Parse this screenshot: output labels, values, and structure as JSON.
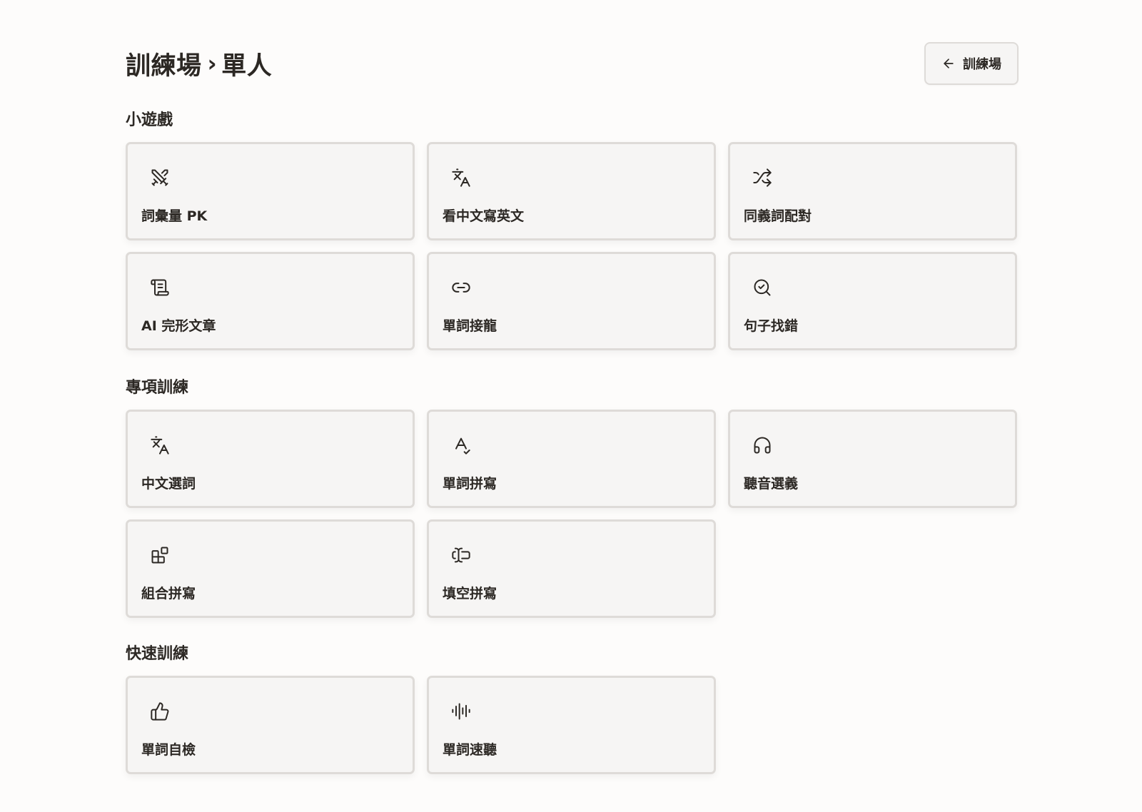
{
  "header": {
    "title_part1": "訓練場",
    "separator": "›",
    "title_part2": "單人",
    "back_button_label": "訓練場"
  },
  "sections": [
    {
      "title": "小遊戲",
      "cards": [
        {
          "label": "詞彙量 PK",
          "icon": "swords-icon"
        },
        {
          "label": "看中文寫英文",
          "icon": "translate-icon"
        },
        {
          "label": "同義詞配對",
          "icon": "shuffle-icon"
        },
        {
          "label": "AI 完形文章",
          "icon": "scroll-icon"
        },
        {
          "label": "單詞接龍",
          "icon": "link-icon"
        },
        {
          "label": "句子找錯",
          "icon": "search-check-icon"
        }
      ]
    },
    {
      "title": "專項訓練",
      "cards": [
        {
          "label": "中文選詞",
          "icon": "translate-icon"
        },
        {
          "label": "單詞拼寫",
          "icon": "spell-check-icon"
        },
        {
          "label": "聽音選義",
          "icon": "headphones-icon"
        },
        {
          "label": "組合拼寫",
          "icon": "blocks-icon"
        },
        {
          "label": "填空拼寫",
          "icon": "text-cursor-input-icon"
        }
      ]
    },
    {
      "title": "快速訓練",
      "cards": [
        {
          "label": "單詞自檢",
          "icon": "thumbs-up-icon"
        },
        {
          "label": "單詞速聽",
          "icon": "audio-lines-icon"
        }
      ]
    }
  ],
  "colors": {
    "background": "#fdfcfb",
    "card_background": "#f6f5f4",
    "card_border": "#dedbd8",
    "text": "#2c2824"
  }
}
